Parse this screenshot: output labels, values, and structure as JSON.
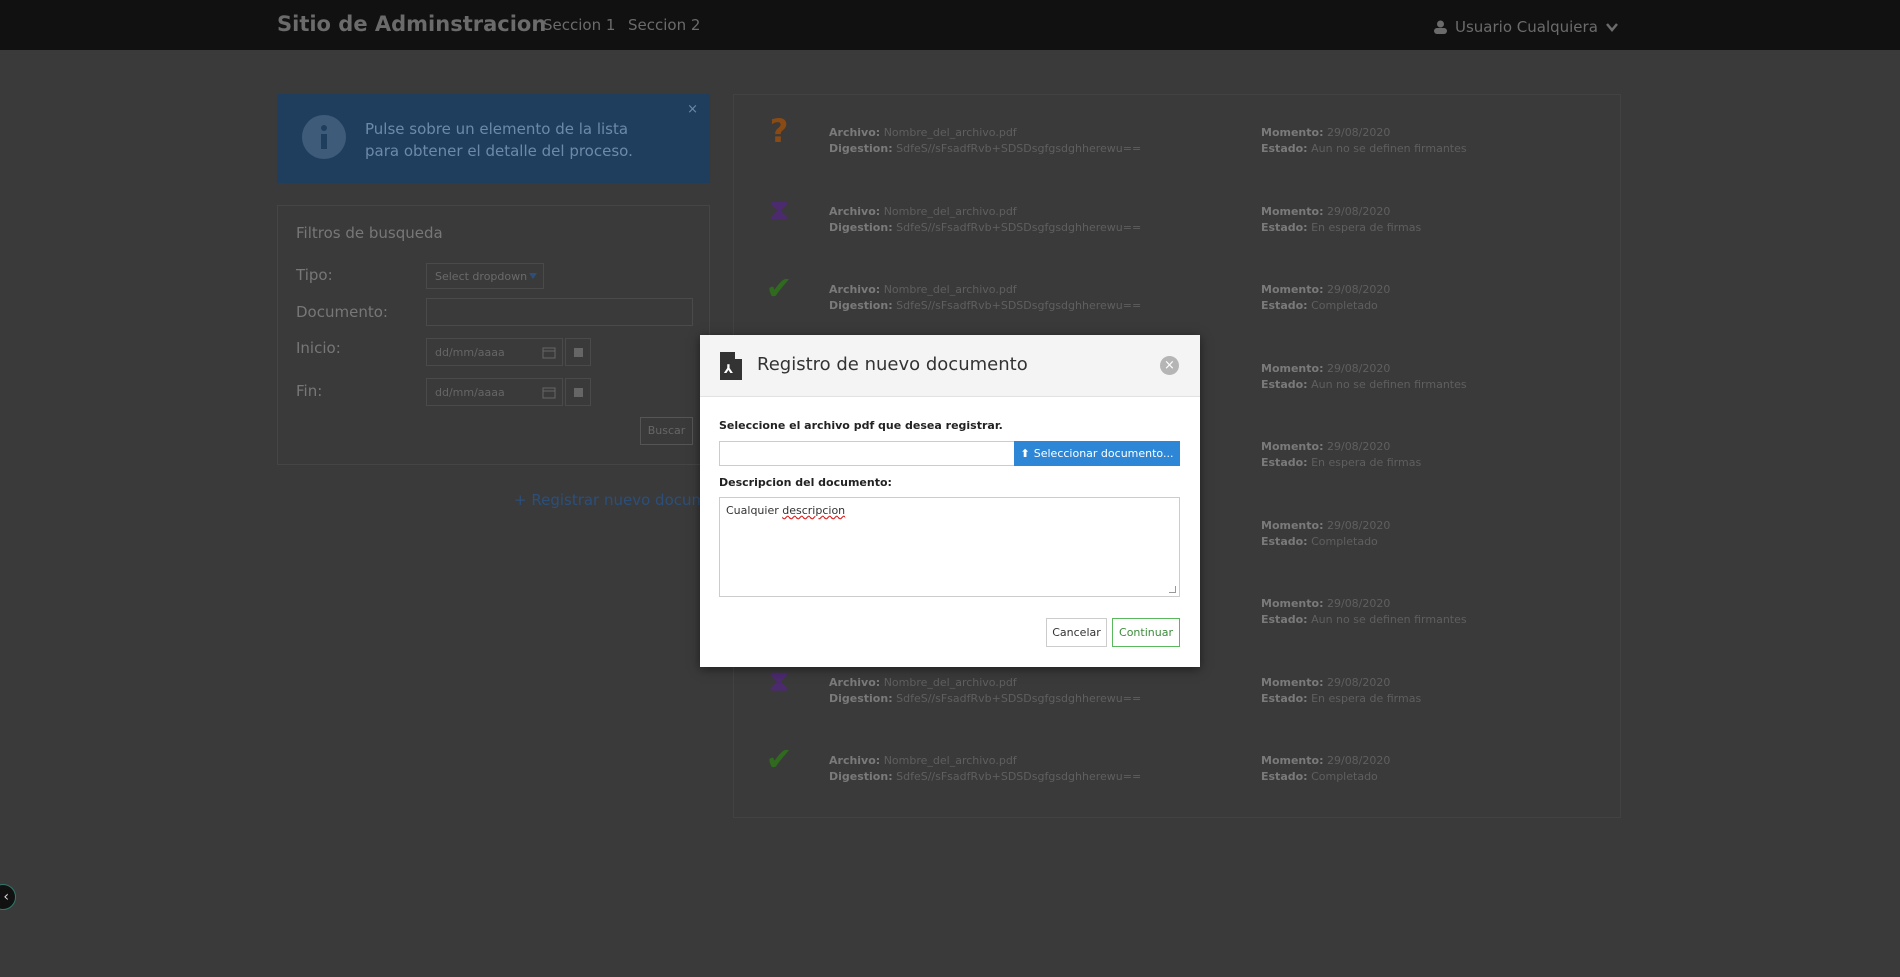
{
  "nav": {
    "brand": "Sitio de Adminstracion",
    "links": [
      "Seccion 1",
      "Seccion 2"
    ],
    "user": "Usuario Cualquiera"
  },
  "info": {
    "text": "Pulse sobre un elemento de la lista para obtener el detalle del proceso.",
    "close": "×"
  },
  "filters": {
    "title": "Filtros de busqueda",
    "tipo_label": "Tipo:",
    "tipo_value": "Select dropdown",
    "documento_label": "Documento:",
    "inicio_label": "Inicio:",
    "fin_label": "Fin:",
    "date_placeholder": "dd/mm/aaaa",
    "buscar": "Buscar"
  },
  "register_link": "+ Registrar nuevo documento",
  "list": {
    "labels": {
      "archivo": "Archivo:",
      "digestion": "Digestion:",
      "momento": "Momento:",
      "estado": "Estado:"
    },
    "items": [
      {
        "icon": "question-icon",
        "archivo": "Nombre_del_archivo.pdf",
        "digestion": "SdfeS//sFsadfRvb+SDSDsgfgsdghherewu==",
        "momento": "29/08/2020",
        "estado": "Aun no se definen firmantes"
      },
      {
        "icon": "hourglass-icon",
        "archivo": "Nombre_del_archivo.pdf",
        "digestion": "SdfeS//sFsadfRvb+SDSDsgfgsdghherewu==",
        "momento": "29/08/2020",
        "estado": "En espera de firmas"
      },
      {
        "icon": "check-icon",
        "archivo": "Nombre_del_archivo.pdf",
        "digestion": "SdfeS//sFsadfRvb+SDSDsgfgsdghherewu==",
        "momento": "29/08/2020",
        "estado": "Completado"
      },
      {
        "icon": "question-icon",
        "archivo": "",
        "digestion": "",
        "momento": "29/08/2020",
        "estado": "Aun no se definen firmantes"
      },
      {
        "icon": "hourglass-icon",
        "archivo": "",
        "digestion": "",
        "momento": "29/08/2020",
        "estado": "En espera de firmas"
      },
      {
        "icon": "check-icon",
        "archivo": "",
        "digestion": "",
        "momento": "29/08/2020",
        "estado": "Completado"
      },
      {
        "icon": "question-icon",
        "archivo": "",
        "digestion": "",
        "momento": "29/08/2020",
        "estado": "Aun no se definen firmantes"
      },
      {
        "icon": "hourglass-icon",
        "archivo": "Nombre_del_archivo.pdf",
        "digestion": "SdfeS//sFsadfRvb+SDSDsgfgsdghherewu==",
        "momento": "29/08/2020",
        "estado": "En espera de firmas"
      },
      {
        "icon": "check-icon",
        "archivo": "Nombre_del_archivo.pdf",
        "digestion": "SdfeS//sFsadfRvb+SDSDsgfgsdghherewu==",
        "momento": "29/08/2020",
        "estado": "Completado"
      }
    ]
  },
  "modal": {
    "title": "Registro de nuevo documento",
    "file_label": "Seleccione el archivo pdf que desea registrar.",
    "file_button": "Seleccionar documento...",
    "desc_label": "Descripcion del documento:",
    "desc_value_1": "Cualquier",
    "desc_value_2": "descripcion",
    "cancel": "Cancelar",
    "continue": "Continuar"
  },
  "colors": {
    "accent_blue": "#2d86d6",
    "success_green": "#5cb85c",
    "nav_bg": "#111111"
  }
}
